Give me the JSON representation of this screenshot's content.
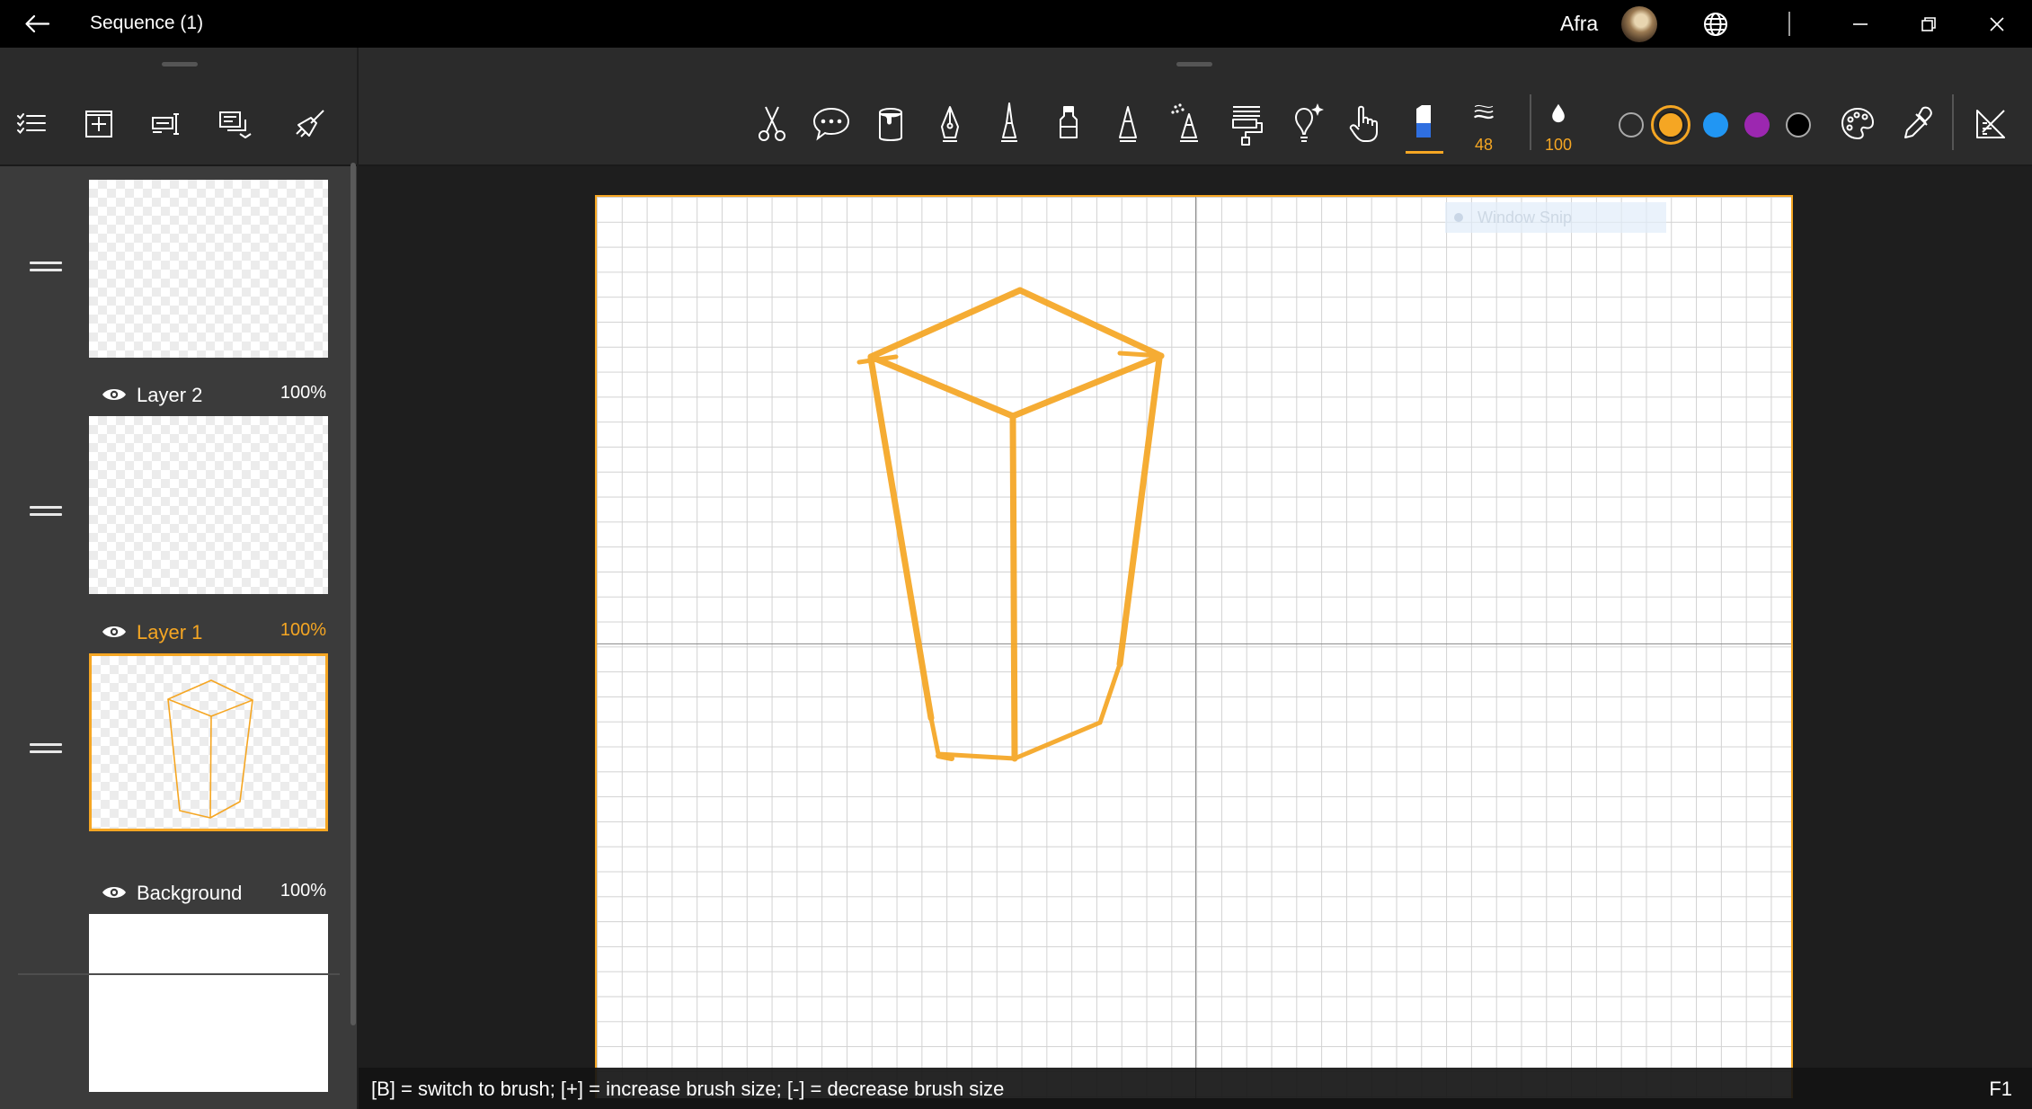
{
  "window": {
    "title": "Sequence (1)",
    "user_name": "Afra"
  },
  "left_toolbar": {
    "icons": [
      "task-list-icon",
      "add-layer-icon",
      "layer-properties-icon",
      "merge-layers-icon",
      "broom-clear-icon"
    ]
  },
  "layers": [
    {
      "name": "",
      "opacity": "",
      "active": false,
      "content": "empty"
    },
    {
      "name": "Layer 2",
      "opacity": "100%",
      "active": false,
      "content": "empty"
    },
    {
      "name": "Layer 1",
      "opacity": "100%",
      "active": true,
      "content": "sketch"
    },
    {
      "name": "Background",
      "opacity": "100%",
      "active": false,
      "content": "white"
    }
  ],
  "toolbar": {
    "tools": [
      "scissors-icon",
      "speech-bubble-icon",
      "paint-bucket-icon",
      "fountain-pen-icon",
      "technical-pen-icon",
      "marker-icon",
      "pencil-icon",
      "airbrush-icon",
      "paint-roller-icon",
      "lightbulb-icon",
      "hand-pointer-icon",
      "eraser-icon"
    ],
    "active_tool": "eraser-icon",
    "brush_size": "48",
    "opacity": "100",
    "colors": [
      "#2b2b2b",
      "#f5a623",
      "#2196f3",
      "#9c27b0",
      "#000000"
    ],
    "selected_color": "#f5a623",
    "extra_tools": [
      "color-palette-icon",
      "eyedropper-icon",
      "ruler-icon"
    ]
  },
  "canvas": {
    "stroke_color": "#f5a623",
    "overlay_text": "Window Snip"
  },
  "status": {
    "hint": "[B] = switch to brush; [+] = increase brush size; [-] = decrease brush size",
    "key": "F1"
  }
}
